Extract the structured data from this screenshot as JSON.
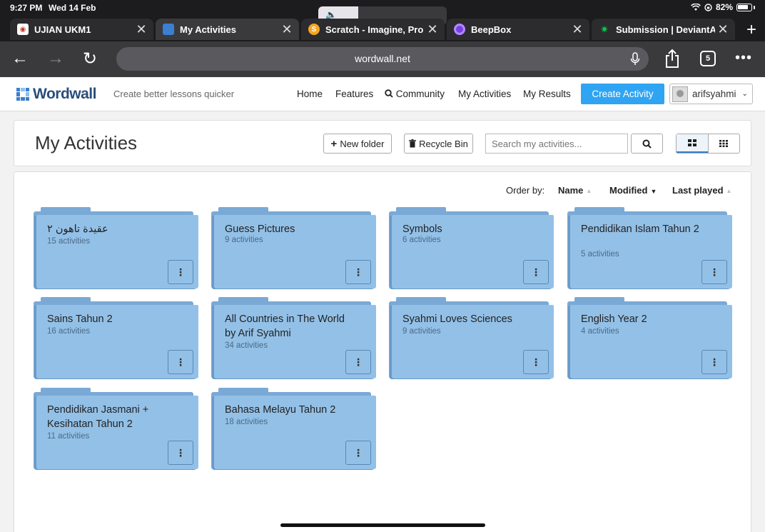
{
  "status_bar": {
    "time": "9:27 PM",
    "date": "Wed 14 Feb",
    "battery": "82%"
  },
  "tabs": [
    {
      "title": "UJIAN UKM1",
      "active": false
    },
    {
      "title": "My Activities",
      "active": true
    },
    {
      "title": "Scratch - Imagine, Pro",
      "active": false
    },
    {
      "title": "BeepBox",
      "active": false
    },
    {
      "title": "Submission | DeviantA",
      "active": false
    }
  ],
  "browser": {
    "url": "wordwall.net",
    "tab_count": "5"
  },
  "site": {
    "logo_text": "Wordwall",
    "tagline": "Create better lessons quicker",
    "nav": {
      "home": "Home",
      "features": "Features",
      "community": "Community",
      "my_activities": "My Activities",
      "my_results": "My Results"
    },
    "create_button": "Create Activity",
    "username": "arifsyahmi"
  },
  "page": {
    "title": "My Activities",
    "new_folder": "New folder",
    "recycle_bin": "Recycle Bin",
    "search_placeholder": "Search my activities..."
  },
  "order": {
    "label": "Order by:",
    "name": "Name",
    "modified": "Modified",
    "last_played": "Last played"
  },
  "folders": [
    {
      "name": "عقيدة تاهون ٢",
      "count": "15 activities"
    },
    {
      "name": "Guess Pictures",
      "count": "9 activities"
    },
    {
      "name": "Symbols",
      "count": "6 activities"
    },
    {
      "name": "Pendidikan Islam Tahun 2",
      "count": "5 activities"
    },
    {
      "name": "Sains Tahun 2",
      "count": "16 activities"
    },
    {
      "name": "All Countries in The World by Arif Syahmi",
      "count": "34 activities"
    },
    {
      "name": "Syahmi Loves Sciences",
      "count": "9 activities"
    },
    {
      "name": "English Year 2",
      "count": "4 activities"
    },
    {
      "name": "Pendidikan Jasmani + Kesihatan Tahun 2",
      "count": "11 activities"
    },
    {
      "name": "Bahasa Melayu Tahun 2",
      "count": "18 activities"
    }
  ]
}
